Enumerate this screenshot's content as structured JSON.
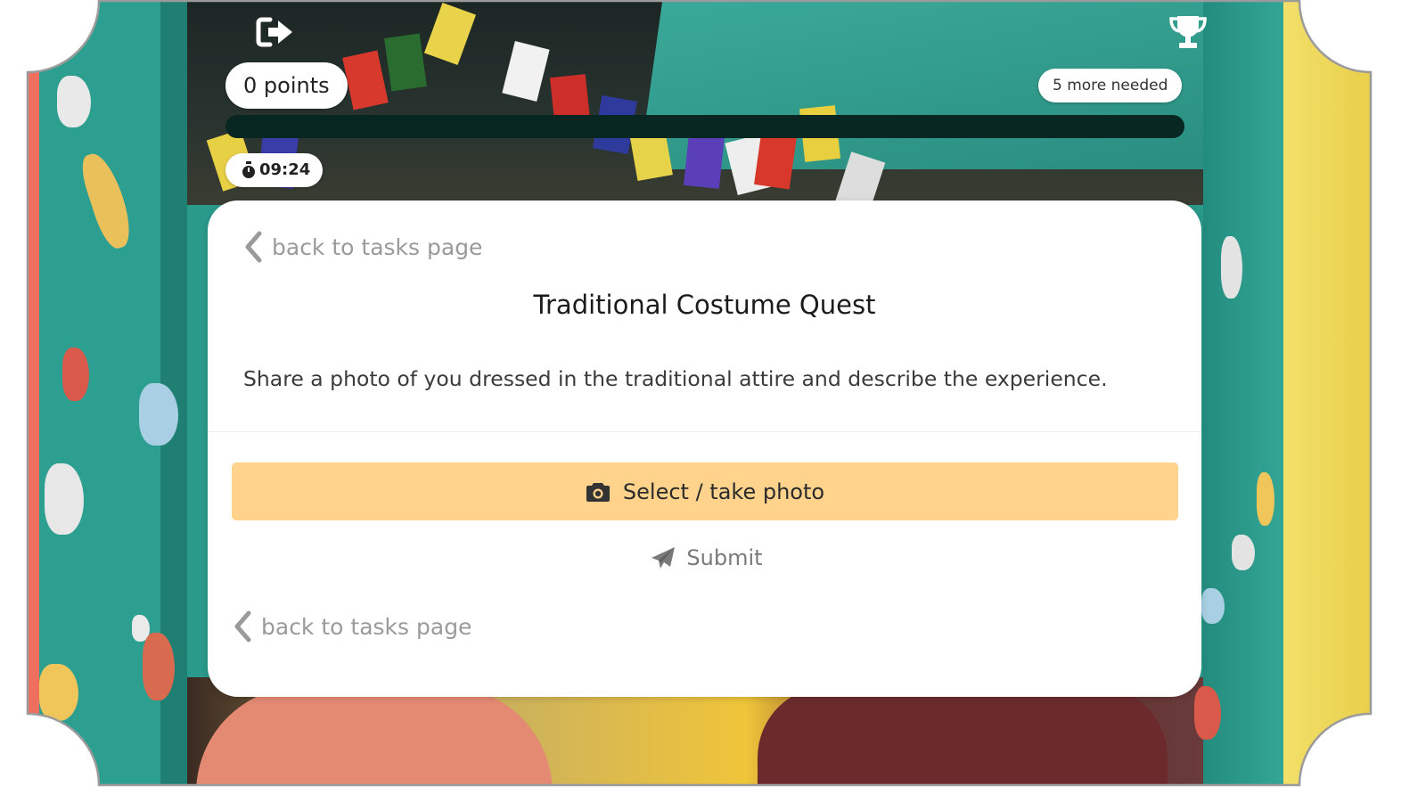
{
  "header": {
    "exit_icon": "sign-out-icon",
    "trophy_icon": "trophy-icon",
    "points_label": "0 points",
    "needed_label": "5 more needed",
    "progress_fraction": 0,
    "timer_icon": "stopwatch-icon",
    "timer_value": "09:24"
  },
  "task": {
    "back_label_top": "back to tasks page",
    "title": "Traditional Costume Quest",
    "description": "Share a photo of you dressed in the traditional attire and describe the experience.",
    "photo_button_label": "Select / take photo",
    "photo_button_icon": "camera-icon",
    "submit_label": "Submit",
    "submit_icon": "paper-plane-icon",
    "back_label_bottom": "back to tasks page",
    "back_icon": "chevron-left-icon"
  },
  "colors": {
    "progress_track": "#082622",
    "progress_fill": "#f7a01c",
    "photo_button_bg": "#ffd38c",
    "link_gray": "#9a9a9a"
  }
}
